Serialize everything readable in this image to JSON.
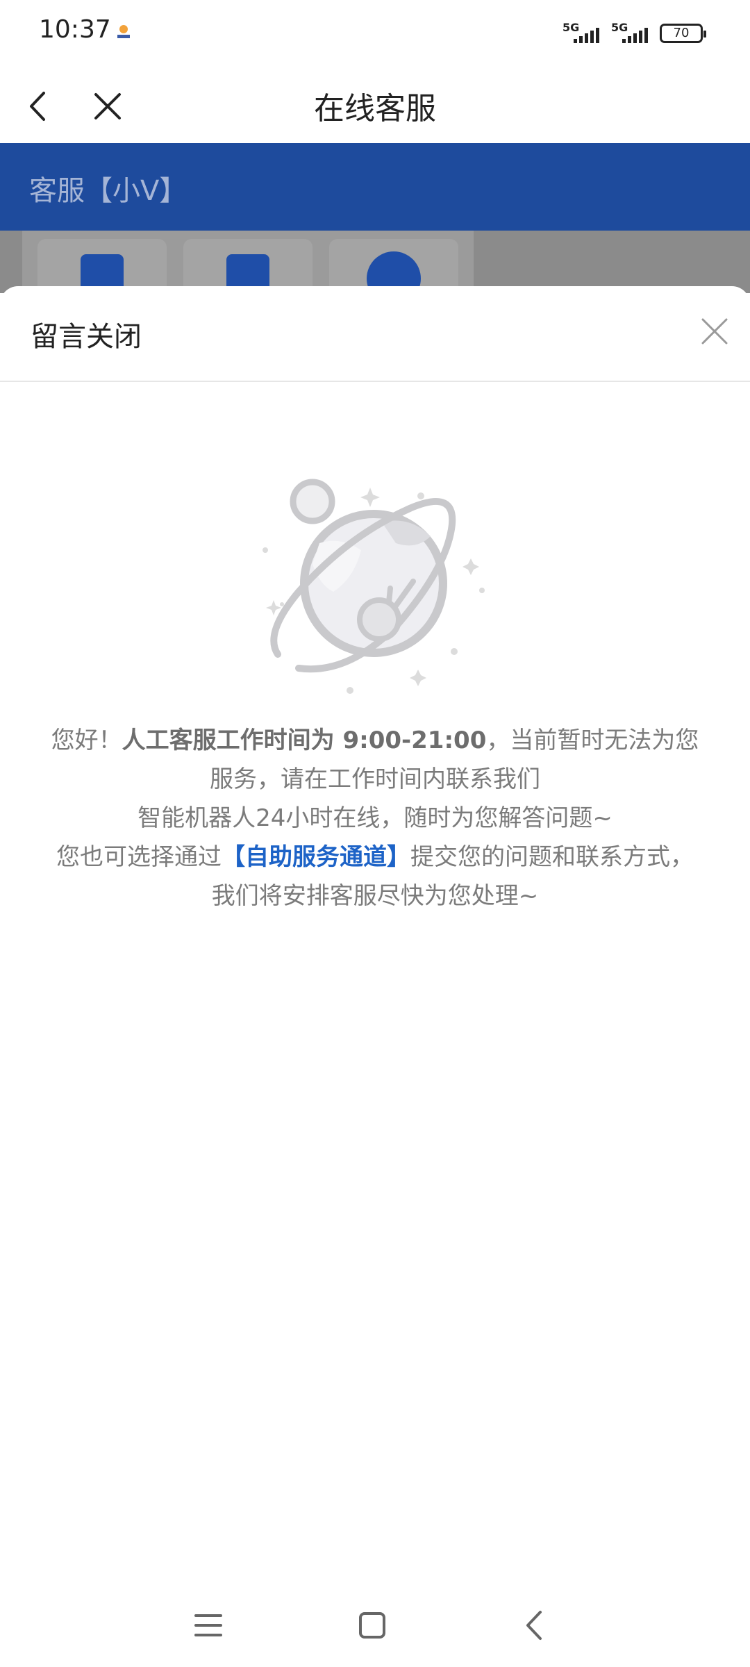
{
  "status_bar": {
    "time": "10:37",
    "app_icon": "app-logo-icon",
    "signal1_tag": "5G",
    "signal2_tag": "5G",
    "battery_level": "70"
  },
  "header": {
    "title": "在线客服",
    "back_icon": "back-arrow-icon",
    "close_icon": "close-icon"
  },
  "banner": {
    "title": "客服【小V】"
  },
  "sheet": {
    "title": "留言关闭",
    "close_icon": "close-icon",
    "illustration": "planet-empty-state-icon",
    "message": {
      "line1_prefix": "您好！",
      "line1_bold": "人工客服工作时间为 9:00-21:00",
      "line1_suffix": "，当前暂时无法为您",
      "line2": "服务，请在工作时间内联系我们",
      "line3": "智能机器人24小时在线，随时为您解答问题~",
      "line4_prefix": "您也可选择通过",
      "line4_link": "【自助服务通道】",
      "line4_suffix": "提交您的问题和联系方式，",
      "line5": "我们将安排客服尽快为您处理~"
    }
  },
  "navbar": {
    "menu_icon": "menu-icon",
    "home_icon": "home-icon",
    "back_icon": "back-icon"
  },
  "colors": {
    "banner_blue": "#1e4b9d",
    "link_blue": "#1d63c7",
    "text_gray": "#7b7b7b"
  }
}
